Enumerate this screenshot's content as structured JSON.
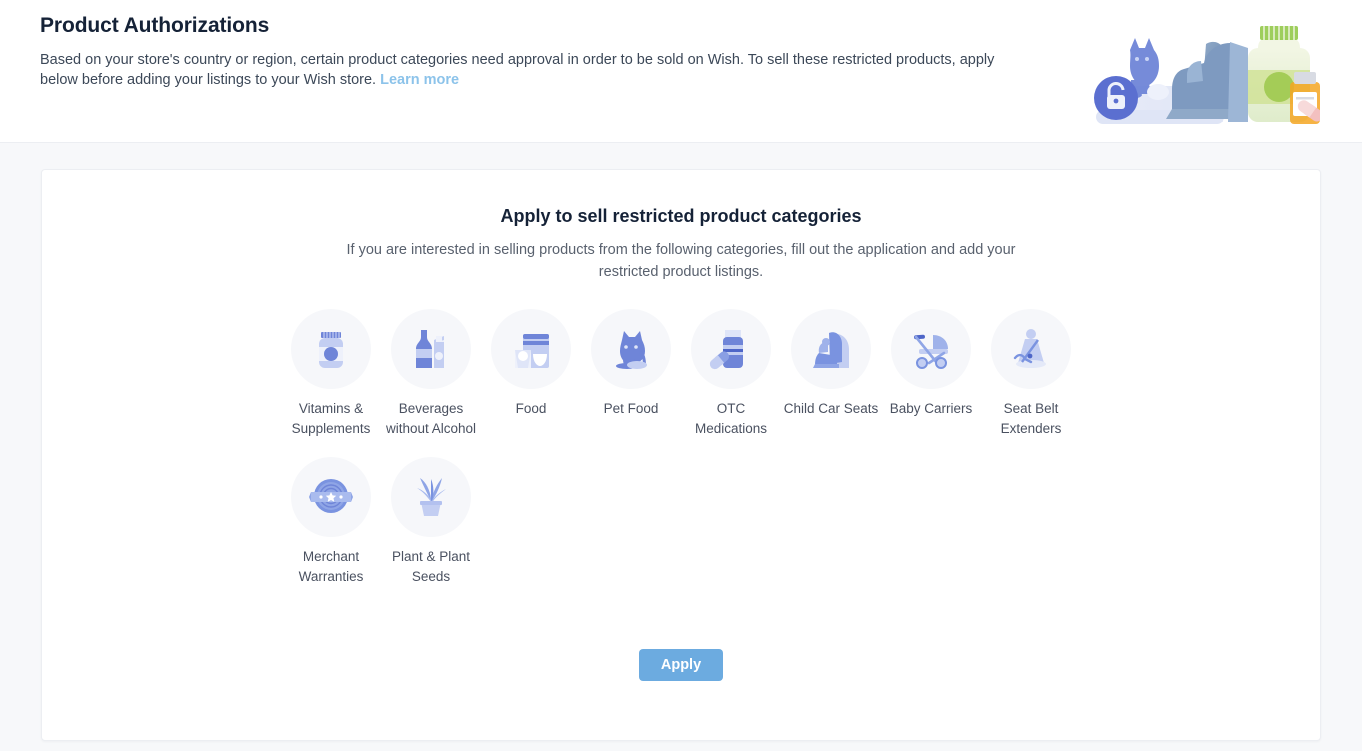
{
  "header": {
    "title": "Product Authorizations",
    "description_before_link": "Based on your store's country or region, certain product categories need approval in order to be sold on Wish. To sell these restricted products, apply below before adding your listings to your Wish store. ",
    "learn_more_label": "Learn more",
    "illustration_name": "restricted-products-illustration"
  },
  "card": {
    "title": "Apply to sell restricted product categories",
    "description": "If you are interested in selling products from the following categories, fill out the application and add your restricted product listings.",
    "apply_button_label": "Apply",
    "categories": [
      {
        "label": "Vitamins & Supplements",
        "icon": "supplement-bottle-icon"
      },
      {
        "label": "Beverages without Alcohol",
        "icon": "beverage-bottle-carton-icon"
      },
      {
        "label": "Food",
        "icon": "food-package-icon"
      },
      {
        "label": "Pet Food",
        "icon": "cat-icon"
      },
      {
        "label": "OTC Medications",
        "icon": "medication-bottle-pill-icon"
      },
      {
        "label": "Child Car Seats",
        "icon": "child-car-seat-icon"
      },
      {
        "label": "Baby Carriers",
        "icon": "stroller-icon"
      },
      {
        "label": "Seat Belt Extenders",
        "icon": "seat-belt-icon"
      },
      {
        "label": "Merchant Warranties",
        "icon": "warranty-badge-icon"
      },
      {
        "label": "Plant & Plant Seeds",
        "icon": "potted-plant-icon"
      }
    ]
  },
  "colors": {
    "accent_blue": "#6cabe0",
    "link_blue": "#8cc3ea",
    "icon_blue": "#7a93e0",
    "icon_light_blue": "#bccbf2",
    "page_background": "#f7f8fa",
    "title_text": "#152237"
  }
}
